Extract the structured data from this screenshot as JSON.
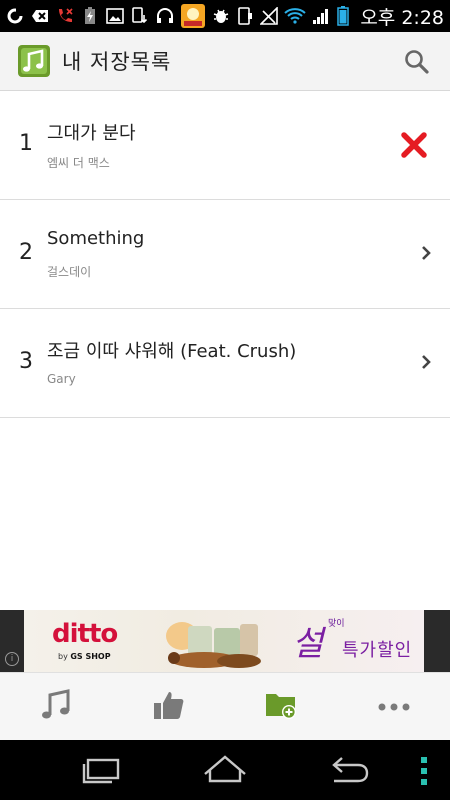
{
  "status_bar": {
    "time": "오후 2:28",
    "icons": [
      "g-icon",
      "notification-icon",
      "missed-call-icon",
      "battery-charging-icon",
      "image-icon",
      "download-icon",
      "headphones-icon",
      "app-badge-icon",
      "bug-icon",
      "phone-outline-icon",
      "signal-mute-icon",
      "wifi-icon",
      "cell-signal-icon",
      "battery-icon"
    ]
  },
  "action_bar": {
    "title": "내 저장목록",
    "app_icon": "music-folder-icon",
    "search_icon": "search-icon",
    "accent_color": "#6a9a2a"
  },
  "songs": [
    {
      "number": "1",
      "title": "그대가 분다",
      "artist": "엠씨 더 맥스",
      "action": "delete"
    },
    {
      "number": "2",
      "title": "Something",
      "artist": "걸스데이",
      "action": "chevron"
    },
    {
      "number": "3",
      "title": "조금 이따 샤워해 (Feat. Crush)",
      "artist": "Gary",
      "action": "chevron"
    }
  ],
  "ad": {
    "brand": "ditto",
    "brand_sub_prefix": "by",
    "brand_sub": "GS SHOP",
    "big_char": "설",
    "small_text": "맞이",
    "promo": "특가할인",
    "info_glyph": "i"
  },
  "bottom_tabs": [
    {
      "icon": "music-note-icon",
      "active": false
    },
    {
      "icon": "thumbs-up-icon",
      "active": false
    },
    {
      "icon": "add-folder-icon",
      "active": true
    },
    {
      "icon": "more-icon",
      "active": false
    }
  ],
  "colors": {
    "delete": "#e51c23",
    "active_tab": "#6a9a2a",
    "inactive_tab": "#7a7a7a",
    "nav_menu": "#2ac0b0"
  }
}
